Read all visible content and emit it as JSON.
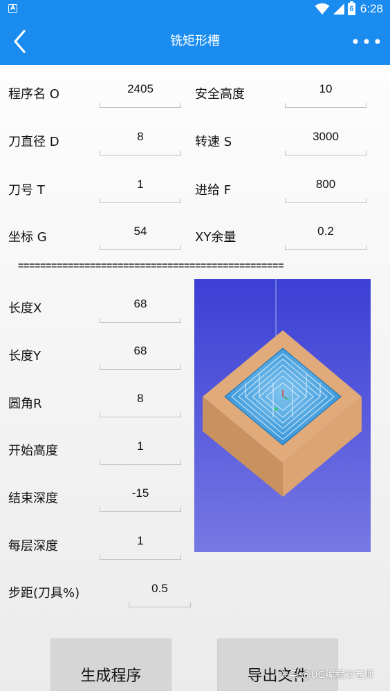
{
  "status_bar": {
    "time": "6:28",
    "battery_level": "6"
  },
  "header": {
    "title": "铣矩形槽"
  },
  "params": {
    "program_name": {
      "label": "程序名 O",
      "value": "2405"
    },
    "safe_height": {
      "label": "安全高度",
      "value": "10"
    },
    "tool_diameter": {
      "label": "刀直径 D",
      "value": "8"
    },
    "spindle_speed": {
      "label": "转速 S",
      "value": "3000"
    },
    "tool_number": {
      "label": "刀号 T",
      "value": "1"
    },
    "feed": {
      "label": "进给 F",
      "value": "800"
    },
    "coordinate": {
      "label": "坐标 G",
      "value": "54"
    },
    "xy_allowance": {
      "label": "XY余量",
      "value": "0.2"
    }
  },
  "divider": "================================================",
  "pocket": {
    "length_x": {
      "label": "长度X",
      "value": "68"
    },
    "length_y": {
      "label": "长度Y",
      "value": "68"
    },
    "corner_radius": {
      "label": "圆角R",
      "value": "8"
    },
    "start_height": {
      "label": "开始高度",
      "value": "1"
    },
    "end_depth": {
      "label": "结束深度",
      "value": "-15"
    },
    "step_depth": {
      "label": "每层深度",
      "value": "1"
    },
    "step_over": {
      "label": "步距(刀具%)",
      "value": "0.5"
    }
  },
  "actions": {
    "generate": "生成程序",
    "export": "导出文件"
  },
  "watermark": "头条 @UG编程安老师",
  "colors": {
    "app_bar": "#1a8cf0",
    "preview_bg_top": "#3b3fd4",
    "preview_bg_bottom": "#7678e4",
    "block_top": "#e0aa7a",
    "block_left": "#c8915f",
    "block_right": "#dca473",
    "pocket_water": "#2c8fd6"
  }
}
